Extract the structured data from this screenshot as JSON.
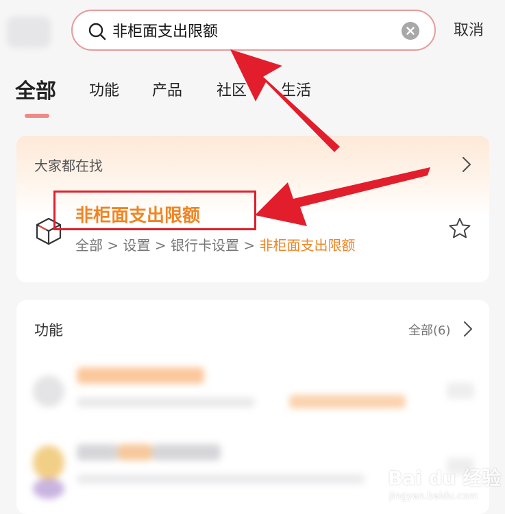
{
  "search": {
    "value": "非柜面支出限额",
    "cancel_label": "取消"
  },
  "tabs": [
    {
      "label": "全部",
      "active": true
    },
    {
      "label": "功能",
      "active": false
    },
    {
      "label": "产品",
      "active": false
    },
    {
      "label": "社区",
      "active": false
    },
    {
      "label": "生活",
      "active": false
    }
  ],
  "popular": {
    "title": "大家都在找",
    "result": {
      "title": "非柜面支出限额",
      "breadcrumb": [
        "全部",
        "设置",
        "银行卡设置",
        "非柜面支出限额"
      ],
      "separator": ">"
    }
  },
  "functions": {
    "title": "功能",
    "more_label": "全部(6)"
  },
  "colors": {
    "accent_orange": "#f08423",
    "tab_indicator": "#f08a86",
    "annotation_red": "#e21e2c"
  },
  "watermark": {
    "main": "Bai du 经验",
    "sub": "jingyan.baidu.com"
  }
}
